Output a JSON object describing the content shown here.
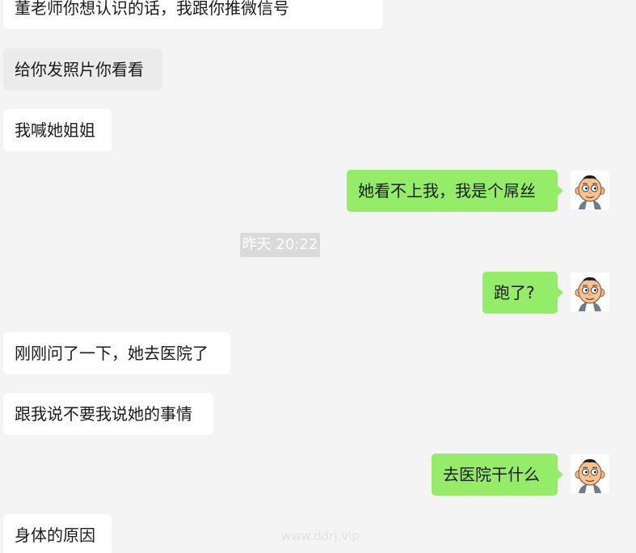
{
  "messages": [
    {
      "text": "董老师你想认识的话，我跟你推微信号",
      "side": "in"
    },
    {
      "text": "给你发照片你看看",
      "side": "in"
    },
    {
      "text": "我喊她姐姐",
      "side": "in"
    },
    {
      "text": "她看不上我，我是个屌丝",
      "side": "out"
    },
    {
      "text": "跑了?",
      "side": "out"
    },
    {
      "text": "刚刚问了一下，她去医院了",
      "side": "in"
    },
    {
      "text": "跟我说不要我说她的事情",
      "side": "in"
    },
    {
      "text": "去医院干什么",
      "side": "out"
    },
    {
      "text": "身体的原因",
      "side": "in"
    }
  ],
  "timestamp": "昨天 20:22",
  "watermark": "www.ddrj.vip",
  "colors": {
    "background": "#f4f4f4",
    "incoming_bubble": "#ffffff",
    "outgoing_bubble": "#95ec69",
    "timestamp_bg": "#dadada"
  },
  "icons": {
    "avatar": "cartoon-boy-avatar-icon"
  }
}
